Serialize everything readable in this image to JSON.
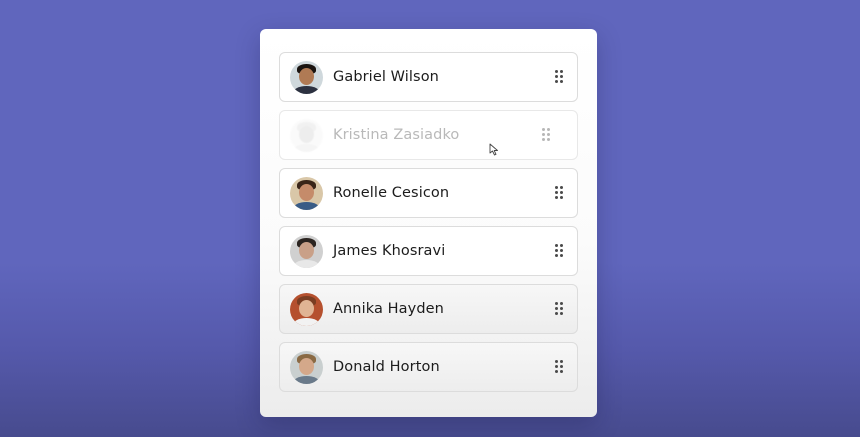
{
  "list": {
    "items": [
      {
        "name": "Gabriel Wilson",
        "avatar_icon": "person-avatar-icon",
        "state": "normal",
        "skin": "#b07a54",
        "hair": "#1a1410",
        "shirt": "#2c3140",
        "bg": "#cfd8dc"
      },
      {
        "name": "Kristina Zasiadko",
        "avatar_icon": "person-avatar-icon",
        "state": "dragging",
        "skin": "#d9b69a",
        "hair": "#d8c9b8",
        "shirt": "#d8d8d8",
        "bg": "#eeeeee"
      },
      {
        "name": "Ronelle Cesicon",
        "avatar_icon": "person-avatar-icon",
        "state": "normal",
        "skin": "#c58b6a",
        "hair": "#3a2518",
        "shirt": "#3a5c86",
        "bg": "#d9c7a8"
      },
      {
        "name": "James Khosravi",
        "avatar_icon": "person-avatar-icon",
        "state": "normal",
        "skin": "#c9a088",
        "hair": "#2b2420",
        "shirt": "#e8e8e8",
        "bg": "#d0d0d0"
      },
      {
        "name": "Annika Hayden",
        "avatar_icon": "person-avatar-icon",
        "state": "shaded",
        "skin": "#e0b494",
        "hair": "#7a3d22",
        "shirt": "#f2f2f2",
        "bg": "#b5502e"
      },
      {
        "name": "Donald Horton",
        "avatar_icon": "person-avatar-icon",
        "state": "shaded",
        "skin": "#d4a88a",
        "hair": "#8a6a44",
        "shirt": "#6a7a8a",
        "bg": "#c9cfcf"
      }
    ],
    "handle_icon": "drag-handle-icon"
  },
  "colors": {
    "background": "#6066bd",
    "card": "#ffffff",
    "item_border": "#dcdcdc",
    "text": "#1c1c1c",
    "dragging_text": "#b9b9b9"
  },
  "cursor_icon": "grab-cursor-icon"
}
